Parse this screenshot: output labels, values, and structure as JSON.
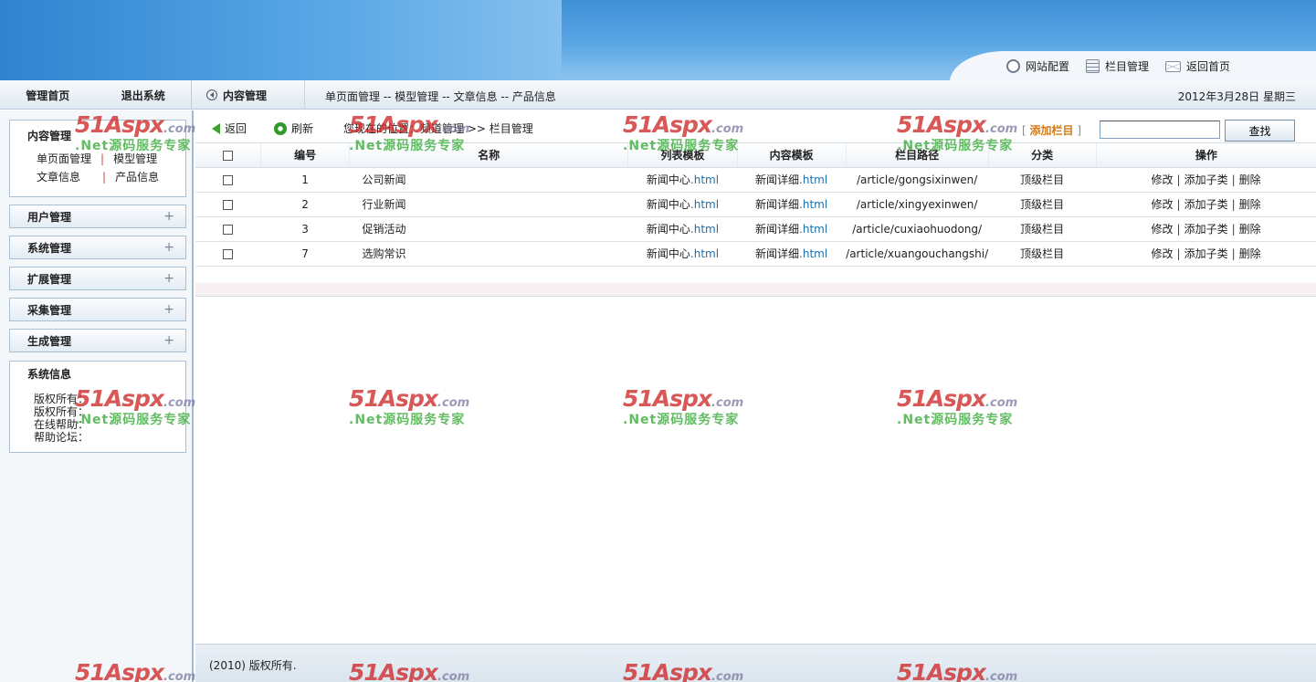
{
  "header": {
    "links": [
      {
        "label": "网站配置",
        "icon": "gear-icon"
      },
      {
        "label": "栏目管理",
        "icon": "list-icon"
      },
      {
        "label": "返回首页",
        "icon": "mail-icon"
      }
    ]
  },
  "subbar": {
    "nav": [
      "管理首页",
      "退出系统"
    ],
    "section": "内容管理",
    "crumbs": "单页面管理 -- 模型管理 -- 文章信息 -- 产品信息",
    "date": "2012年3月28日 星期三"
  },
  "sidebar": {
    "content_title": "内容管理",
    "content_links": [
      "单页面管理",
      "模型管理",
      "文章信息",
      "产品信息"
    ],
    "link_sep": "|",
    "menus": [
      {
        "label": "用户管理",
        "expand": "+"
      },
      {
        "label": "系统管理",
        "expand": "+"
      },
      {
        "label": "扩展管理",
        "expand": "+"
      },
      {
        "label": "采集管理",
        "expand": "+"
      },
      {
        "label": "生成管理",
        "expand": "+"
      }
    ],
    "info_title": "系统信息",
    "info_lines": [
      "版权所有：",
      "版权所有：",
      "在线帮助：",
      "帮助论坛："
    ]
  },
  "toolbar": {
    "back": "返回",
    "refresh": "刷新",
    "location": "您现在的位置：频道管理 >> 栏目管理",
    "add_open": "[",
    "add_label": "添加栏目",
    "add_close": "]",
    "search_value": "",
    "search_button": "查找"
  },
  "table": {
    "headers": [
      "编号",
      "名称",
      "列表模板",
      "内容模板",
      "栏目路径",
      "分类",
      "操作"
    ],
    "rows": [
      {
        "id": "1",
        "name": "公司新闻",
        "list_tpl_name": "新闻中心",
        "list_tpl_ext": ".html",
        "content_tpl_name": "新闻详细",
        "content_tpl_ext": ".html",
        "path": "/article/gongsixinwen/",
        "category": "顶级栏目"
      },
      {
        "id": "2",
        "name": "行业新闻",
        "list_tpl_name": "新闻中心",
        "list_tpl_ext": ".html",
        "content_tpl_name": "新闻详细",
        "content_tpl_ext": ".html",
        "path": "/article/xingyexinwen/",
        "category": "顶级栏目"
      },
      {
        "id": "3",
        "name": "促销活动",
        "list_tpl_name": "新闻中心",
        "list_tpl_ext": ".html",
        "content_tpl_name": "新闻详细",
        "content_tpl_ext": ".html",
        "path": "/article/cuxiaohuodong/",
        "category": "顶级栏目"
      },
      {
        "id": "7",
        "name": "选购常识",
        "list_tpl_name": "新闻中心",
        "list_tpl_ext": ".html",
        "content_tpl_name": "新闻详细",
        "content_tpl_ext": ".html",
        "path": "/article/xuangouchangshi/",
        "category": "顶级栏目"
      }
    ],
    "ops": [
      "修改",
      "添加子类",
      "删除"
    ],
    "ops_sep": "|"
  },
  "footer": {
    "text": "(2010) 版权所有."
  },
  "watermark": {
    "logo": "51Aspx",
    "logo_suffix": ".com",
    "tagline": ".Net源码服务专家"
  },
  "colors": {
    "banner": "#3e8fd6",
    "accent_link": "#d27b1a",
    "ext_link": "#1a6fa8",
    "watermark_red": "#cd2828",
    "watermark_green": "#3caa3c"
  }
}
